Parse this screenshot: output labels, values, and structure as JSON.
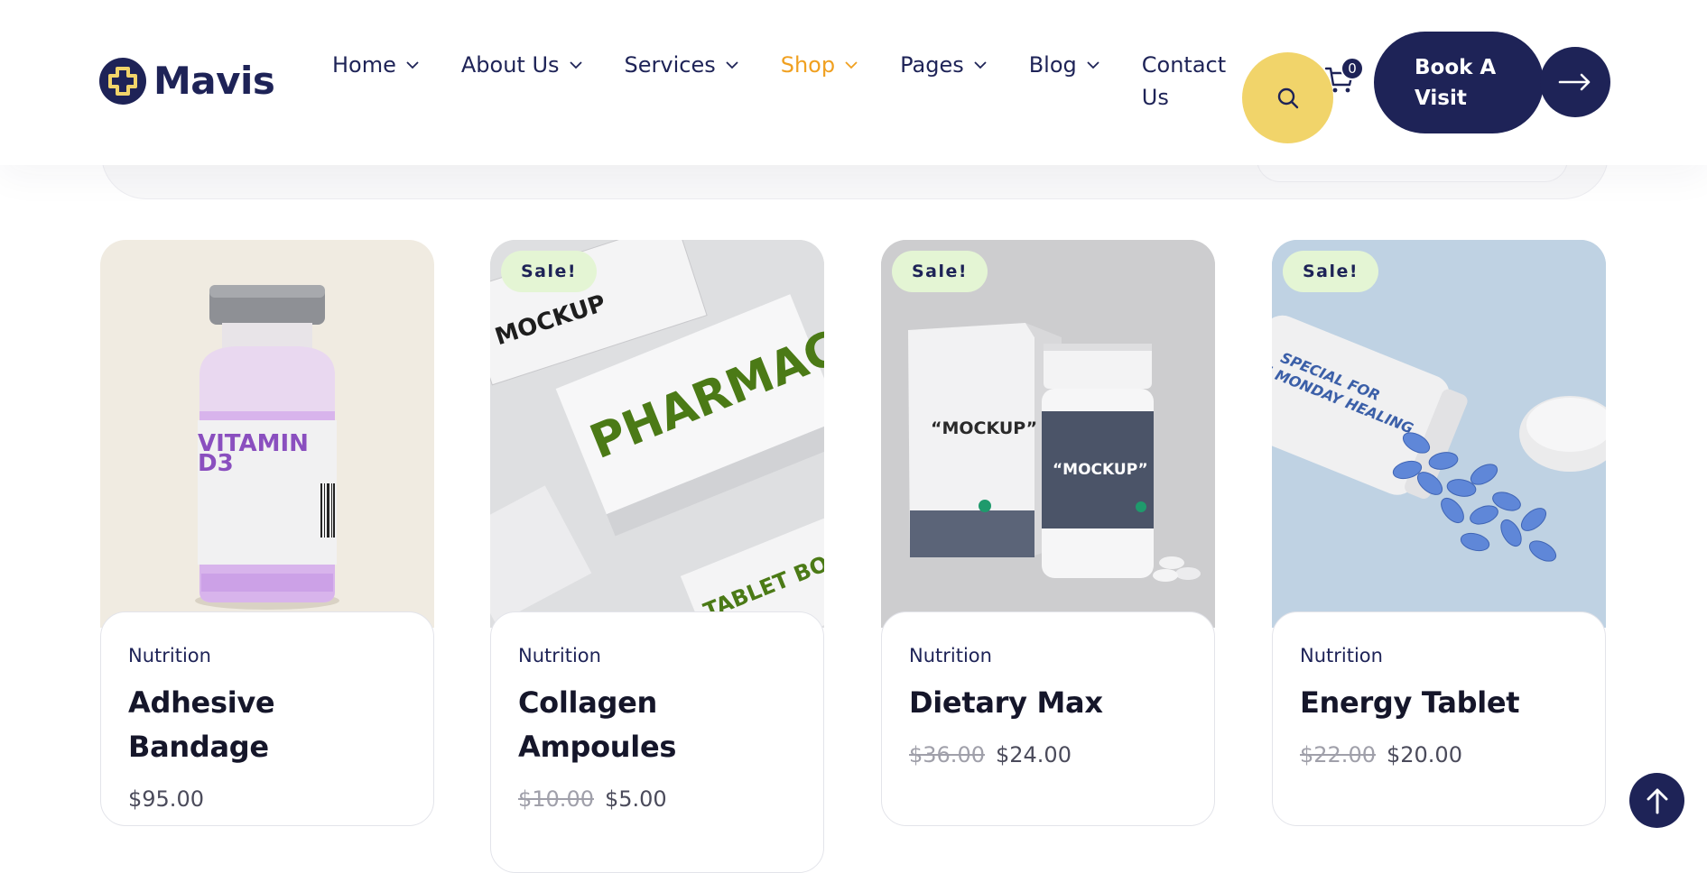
{
  "brand": {
    "name": "Mavis"
  },
  "nav": {
    "items": [
      {
        "label": "Home",
        "active": false
      },
      {
        "label": "About Us",
        "active": false
      },
      {
        "label": "Services",
        "active": false
      },
      {
        "label": "Shop",
        "active": true
      },
      {
        "label": "Pages",
        "active": false
      },
      {
        "label": "Blog",
        "active": false
      },
      {
        "label": "Contact Us",
        "active": false
      }
    ]
  },
  "header": {
    "search_icon": "search-icon",
    "cart_icon": "cart-icon",
    "cart_count": "0",
    "book_label": "Book A Visit",
    "arrow_icon": "arrow-right-icon"
  },
  "products": [
    {
      "sale": "",
      "category": "Nutrition",
      "title": "Adhesive Bandage",
      "price_old": "",
      "price": "$95.00"
    },
    {
      "sale": "Sale!",
      "category": "Nutrition",
      "title": "Collagen Ampoules",
      "price_old": "$10.00",
      "price": "$5.00"
    },
    {
      "sale": "Sale!",
      "category": "Nutrition",
      "title": "Dietary Max",
      "price_old": "$36.00",
      "price": "$24.00"
    },
    {
      "sale": "Sale!",
      "category": "Nutrition",
      "title": "Energy Tablet",
      "price_old": "$22.00",
      "price": "$20.00"
    }
  ],
  "images": {
    "vitamin": {
      "line1": "VITAMIN",
      "line2": "D3"
    },
    "pharmacy": {
      "main": "PHARMACY",
      "tablet": "TABLET BOX",
      "mockup": "MOCKUP"
    },
    "mockup_box": {
      "label": "“MOCKUP”"
    },
    "mockup_bottle": {
      "label": "“MOCKUP”"
    },
    "pill_bottle": {
      "line1": "SPECIAL FOR",
      "line2": "E MONDAY HEALING"
    }
  },
  "colors": {
    "navy": "#1e2357",
    "accent_yellow": "#f1d46a",
    "active_orange": "#f0a020",
    "sale_green": "#e4f5d4"
  },
  "scroll_top_icon": "arrow-up-icon"
}
